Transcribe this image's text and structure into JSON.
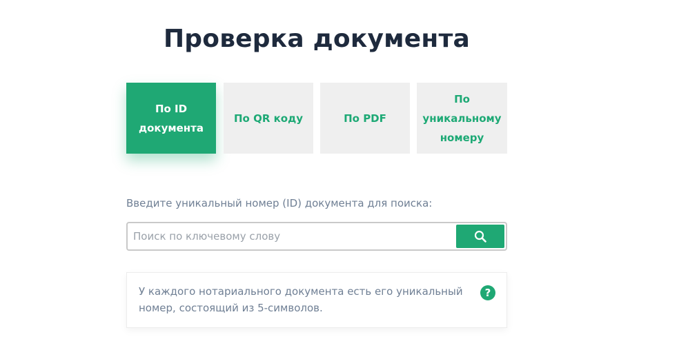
{
  "page": {
    "title": "Проверка документа"
  },
  "tabs": [
    {
      "label": "По ID документа",
      "active": true
    },
    {
      "label": "По QR коду",
      "active": false
    },
    {
      "label": "По PDF",
      "active": false
    },
    {
      "label": "По уникальному номеру",
      "active": false
    }
  ],
  "search": {
    "prompt": "Введите уникальный номер (ID) документа для поиска:",
    "placeholder": "Поиск по ключевому слову",
    "value": "",
    "button_icon": "search-icon"
  },
  "info": {
    "text": "У каждого нотариального документа есть его уникальный номер, состоящий из 5-символов.",
    "help_icon": "question-icon",
    "help_glyph": "?"
  },
  "colors": {
    "accent": "#1fa874",
    "title": "#1e2a3d",
    "tab_bg": "#efefef",
    "muted_text": "#6f7f94"
  }
}
